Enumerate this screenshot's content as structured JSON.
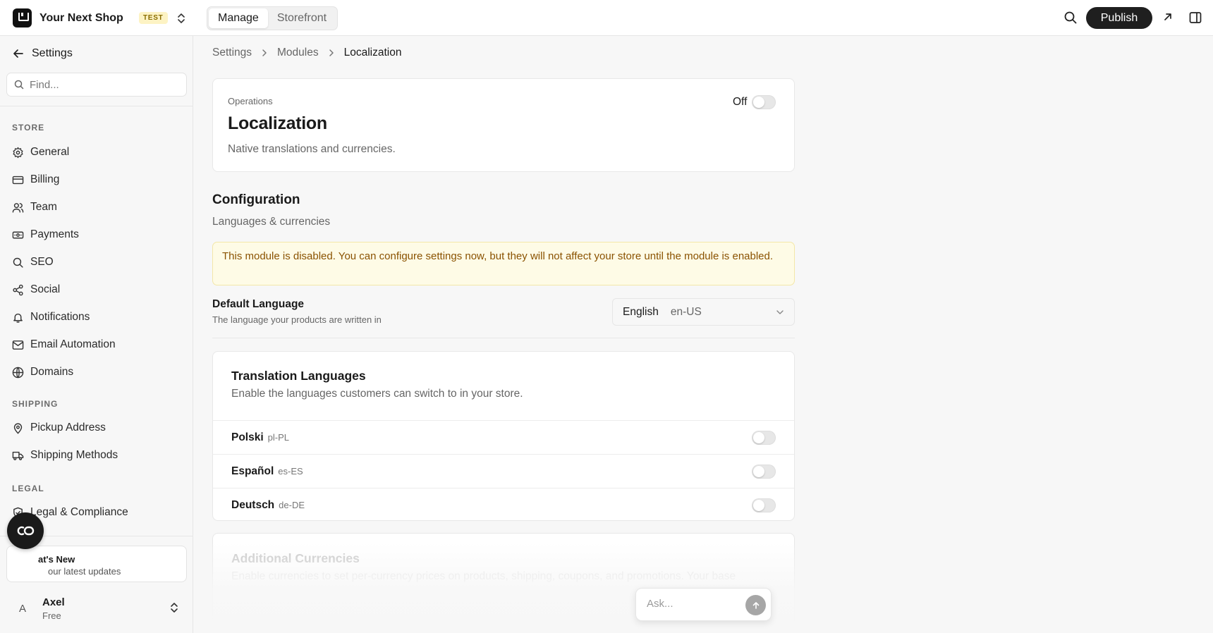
{
  "topbar": {
    "shop_name": "Your Next Shop",
    "badge": "TEST",
    "tabs": [
      {
        "label": "Manage",
        "active": true
      },
      {
        "label": "Storefront",
        "active": false
      }
    ],
    "publish_label": "Publish"
  },
  "sidebar": {
    "back_label": "Settings",
    "find_placeholder": "Find...",
    "sections": [
      {
        "label": "STORE",
        "items": [
          "General",
          "Billing",
          "Team",
          "Payments",
          "SEO",
          "Social",
          "Notifications",
          "Email Automation",
          "Domains"
        ]
      },
      {
        "label": "SHIPPING",
        "items": [
          "Pickup Address",
          "Shipping Methods"
        ]
      },
      {
        "label": "LEGAL",
        "items": [
          "Legal & Compliance"
        ]
      }
    ],
    "whats_new": {
      "title": "at's New",
      "subtitle": "our latest updates"
    },
    "user": {
      "avatar": "A",
      "name": "Axel",
      "plan": "Free"
    }
  },
  "breadcrumb": [
    "Settings",
    "Modules",
    "Localization"
  ],
  "module": {
    "eyebrow": "Operations",
    "title": "Localization",
    "description": "Native translations and currencies.",
    "toggle_label": "Off",
    "enabled": false
  },
  "configuration": {
    "title": "Configuration",
    "subtitle": "Languages & currencies",
    "warning": "This module is disabled. You can configure settings now, but they will not affect your store until the module is enabled.",
    "default_language": {
      "title": "Default Language",
      "subtitle": "The language your products are written in",
      "value_name": "English",
      "value_code": "en-US"
    }
  },
  "translation_languages": {
    "title": "Translation Languages",
    "subtitle": "Enable the languages customers can switch to in your store.",
    "languages": [
      {
        "name": "Polski",
        "code": "pl-PL",
        "enabled": false
      },
      {
        "name": "Español",
        "code": "es-ES",
        "enabled": false
      },
      {
        "name": "Deutsch",
        "code": "de-DE",
        "enabled": false
      }
    ]
  },
  "additional_currencies": {
    "title": "Additional Currencies",
    "subtitle": "Enable currencies to set per-currency prices on products, shipping, coupons, and promotions. Your base"
  },
  "ask": {
    "placeholder": "Ask..."
  },
  "colors": {
    "accent": "#1f1f1f",
    "warning_bg": "#fefbe6",
    "warning_text": "#8a5200",
    "badge_bg": "#fdf3c4"
  }
}
